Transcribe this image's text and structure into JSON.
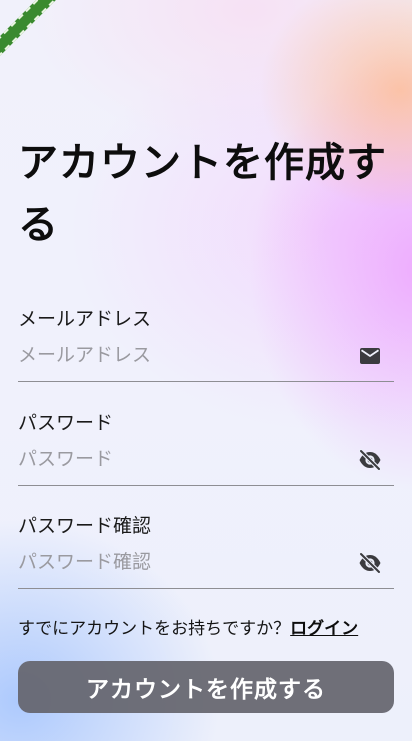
{
  "page": {
    "title": "アカウントを作成する"
  },
  "form": {
    "email": {
      "label": "メールアドレス",
      "placeholder": "メールアドレス",
      "value": "",
      "icon": "mail-icon"
    },
    "password": {
      "label": "パスワード",
      "placeholder": "パスワード",
      "value": "",
      "icon": "visibility-off-icon"
    },
    "password_confirm": {
      "label": "パスワード確認",
      "placeholder": "パスワード確認",
      "value": "",
      "icon": "visibility-off-icon"
    }
  },
  "login_prompt": {
    "text": "すでにアカウントをお持ちですか？",
    "link_label": "ログイン"
  },
  "submit": {
    "label": "アカウントを作成する"
  },
  "colors": {
    "button_bg": "#64646c",
    "divider": "#8e8e93",
    "placeholder": "#9a9aa0",
    "debug_banner": "#3a8a2f"
  }
}
